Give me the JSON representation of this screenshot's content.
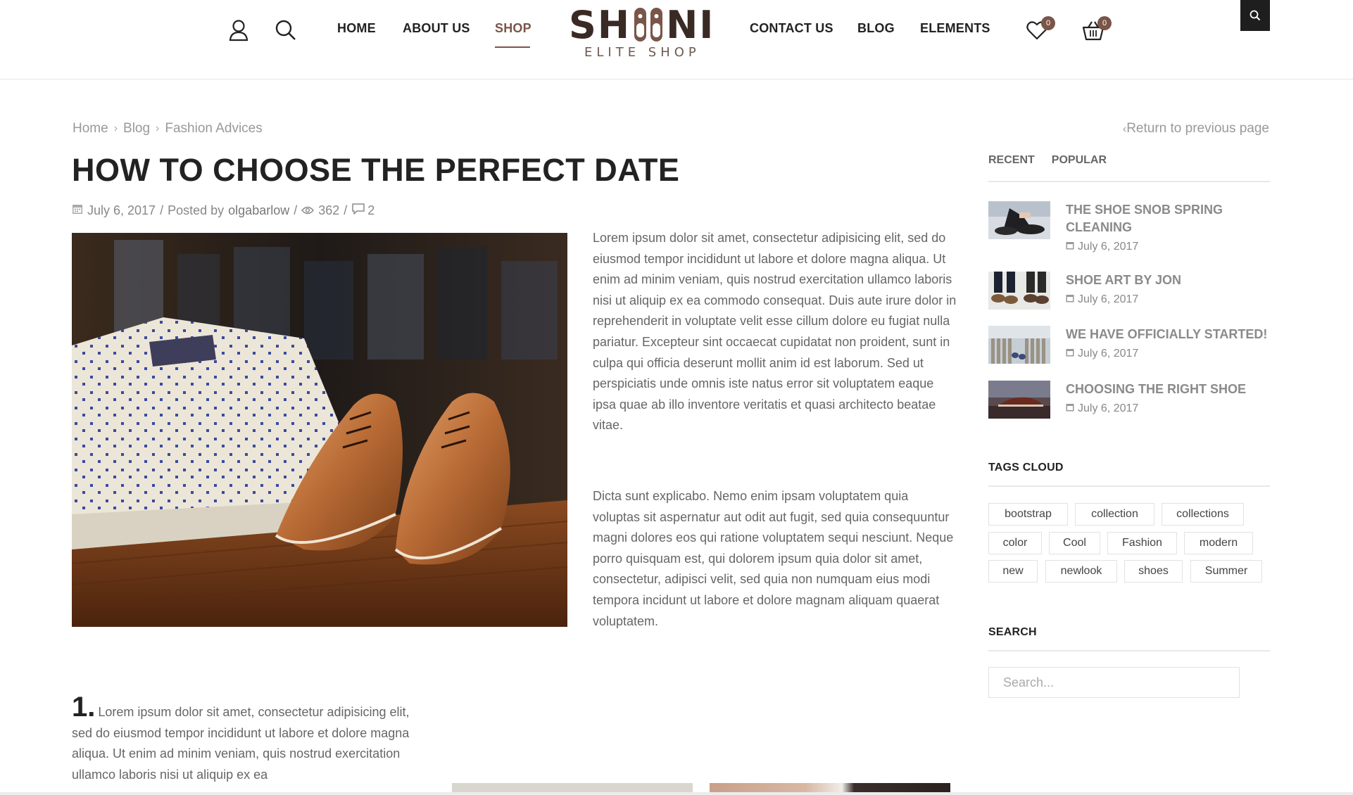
{
  "header": {
    "nav_left": [
      "HOME",
      "ABOUT US",
      "SHOP"
    ],
    "nav_right": [
      "CONTACT US",
      "BLOG",
      "ELEMENTS"
    ],
    "active_nav": "SHOP",
    "logo": {
      "left": "SH",
      "right": "NI",
      "tagline": "ELITE SHOP"
    },
    "wishlist_count": "0",
    "cart_count": "0",
    "icons": [
      "user-icon",
      "search-icon",
      "heart-icon",
      "basket-icon"
    ],
    "accent_color": "#7a5548"
  },
  "breadcrumb": {
    "items": [
      "Home",
      "Blog",
      "Fashion Advices"
    ],
    "return_label": "Return to previous page"
  },
  "post": {
    "title": "HOW TO CHOOSE THE PERFECT DATE",
    "date": "July 6, 2017",
    "posted_by_label": "Posted by",
    "author": "olgabarlow",
    "views": "362",
    "comments": "2",
    "paragraph1": "Lorem ipsum dolor sit amet, consectetur adipisicing elit, sed do eiusmod tempor incididunt ut labore et dolore magna aliqua. Ut enim ad minim veniam, quis nostrud exercitation ullamco laboris nisi ut aliquip ex ea commodo consequat. Duis aute irure dolor in reprehenderit in voluptate velit esse cillum dolore eu fugiat nulla pariatur. Excepteur sint occaecat cupidatat non proident, sunt in culpa qui officia deserunt mollit anim id est laborum. Sed ut perspiciatis unde omnis iste natus error sit voluptatem  eaque ipsa quae ab illo inventore veritatis et quasi architecto beatae vitae.",
    "paragraph2": "Dicta sunt explicabo. Nemo enim ipsam voluptatem quia voluptas sit aspernatur aut odit aut fugit, sed quia consequuntur magni dolores eos qui ratione voluptatem sequi nesciunt. Neque porro quisquam est, qui dolorem ipsum quia dolor sit amet, consectetur, adipisci velit, sed quia non numquam eius modi tempora incidunt ut labore et dolore magnam aliquam quaerat voluptatem.",
    "numbered_1_number": "1.",
    "numbered_1_text": "Lorem ipsum dolor sit amet, consectetur adipisicing elit, sed do eiusmod tempor incididunt ut labore et dolore magna aliqua. Ut enim ad minim veniam, quis nostrud exercitation ullamco laboris nisi ut aliquip ex ea"
  },
  "sidebar": {
    "tabs": [
      "RECENT",
      "POPULAR"
    ],
    "recent_posts": [
      {
        "title": "THE SHOE SNOB SPRING CLEANING",
        "date": "July 6, 2017"
      },
      {
        "title": "SHOE ART BY JON",
        "date": "July 6, 2017"
      },
      {
        "title": "WE HAVE OFFICIALLY STARTED!",
        "date": "July 6, 2017"
      },
      {
        "title": "CHOOSING THE RIGHT SHOE",
        "date": "July 6, 2017"
      }
    ],
    "tags_heading": "TAGS CLOUD",
    "tags": [
      "bootstrap",
      "collection",
      "collections",
      "color",
      "Cool",
      "Fashion",
      "modern",
      "new",
      "newlook",
      "shoes",
      "Summer"
    ],
    "search_heading": "SEARCH",
    "search_placeholder": "Search..."
  }
}
